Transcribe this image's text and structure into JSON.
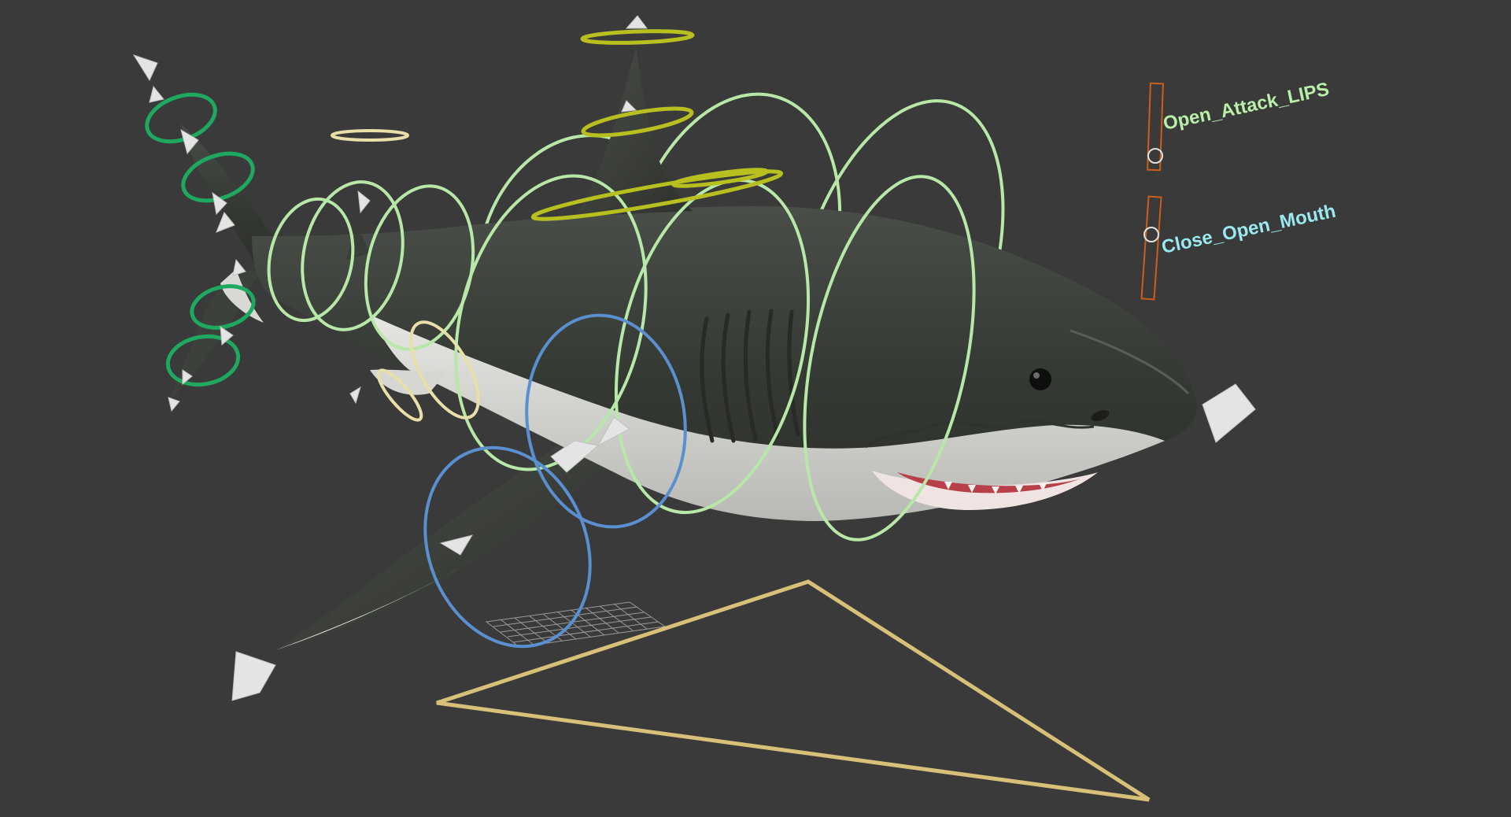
{
  "viewport": {
    "background": "#3a3a3a",
    "object": "shark rig"
  },
  "controls": {
    "open_attack_lips": {
      "label": "Open_Attack_LIPS",
      "color": "#b8f0a8",
      "frame_color": "#c8601c"
    },
    "close_open_mouth": {
      "label": "Close_Open_Mouth",
      "color": "#9ae8f0",
      "frame_color": "#c8601c"
    }
  },
  "colors": {
    "spine_ring": "#b8e8a8",
    "tail_ring": "#1fa860",
    "fin_ring": "#5a8fd0",
    "dorsal_ring": "#b8c020",
    "pelvic_ring": "#e8e0a8",
    "ground_triangle": "#d8c078",
    "shark_body": "#3a3e38",
    "shark_belly": "#dcdcd8",
    "helper": "#e4e4e4"
  }
}
